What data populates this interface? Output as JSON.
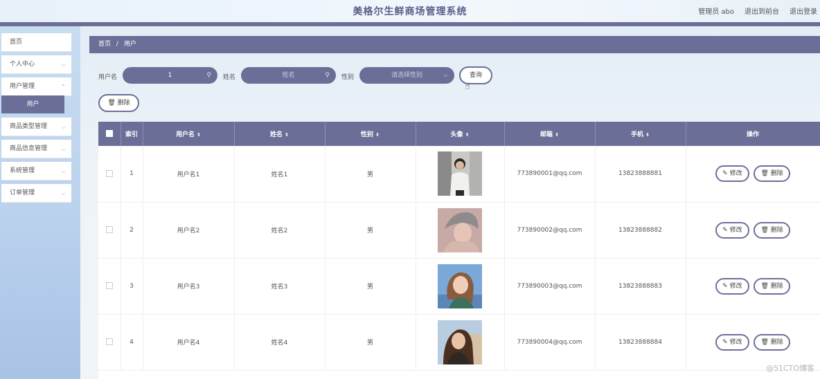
{
  "header": {
    "title": "美格尔生鲜商场管理系统",
    "admin_label": "管理员 abo",
    "to_front": "退出到前台",
    "logout": "退出登录"
  },
  "sidebar": {
    "items": [
      {
        "label": "首页"
      },
      {
        "label": "个人中心"
      },
      {
        "label": "用户管理"
      },
      {
        "label": "用户"
      },
      {
        "label": "商品类型管理"
      },
      {
        "label": "商品信息管理"
      },
      {
        "label": "系统管理"
      },
      {
        "label": "订单管理"
      }
    ]
  },
  "breadcrumb": {
    "home": "首页",
    "sep": "/",
    "current": "用户"
  },
  "search": {
    "username_label": "用户名",
    "username_value": "1",
    "name_label": "姓名",
    "name_placeholder": "姓名",
    "gender_label": "性别",
    "gender_placeholder": "请选择性别",
    "query_button": "查询",
    "delete_button": "删除"
  },
  "table": {
    "headers": {
      "index": "索引",
      "username": "用户名",
      "name": "姓名",
      "gender": "性别",
      "avatar": "头像",
      "email": "邮箱",
      "phone": "手机",
      "actions": "操作"
    },
    "edit_label": "修改",
    "delete_label": "删除",
    "rows": [
      {
        "index": "1",
        "username": "用户名1",
        "name": "姓名1",
        "gender": "男",
        "email": "773890001@qq.com",
        "phone": "13823888881"
      },
      {
        "index": "2",
        "username": "用户名2",
        "name": "姓名2",
        "gender": "男",
        "email": "773890002@qq.com",
        "phone": "13823888882"
      },
      {
        "index": "3",
        "username": "用户名3",
        "name": "姓名3",
        "gender": "男",
        "email": "773890003@qq.com",
        "phone": "13823888883"
      },
      {
        "index": "4",
        "username": "用户名4",
        "name": "姓名4",
        "gender": "男",
        "email": "773890004@qq.com",
        "phone": "13823888884"
      }
    ]
  },
  "watermark": "@51CTO博客",
  "colors": {
    "primary": "#6b6f98",
    "sidebar_bg": "#bcd3ee"
  }
}
